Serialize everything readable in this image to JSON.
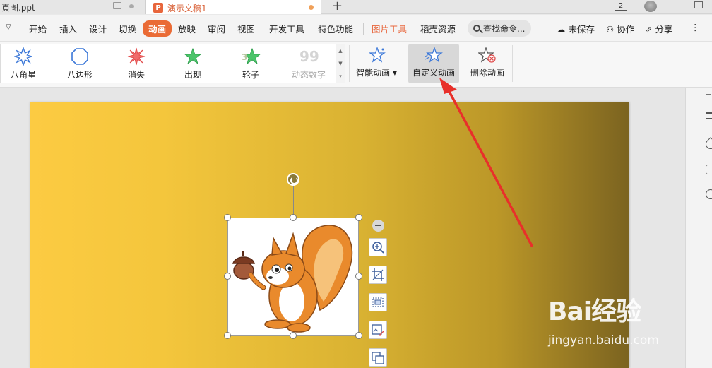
{
  "tabs": [
    {
      "label": "頁图.ppt"
    },
    {
      "label": "演示文稿1",
      "logo": "P"
    }
  ],
  "window": {
    "count": "2"
  },
  "menu": {
    "items": [
      "开始",
      "插入",
      "设计",
      "切换",
      "动画",
      "放映",
      "审阅",
      "视图",
      "开发工具",
      "特色功能"
    ],
    "active": "动画",
    "picture_tools": "图片工具",
    "daoke": "稻壳资源",
    "search_placeholder": "查找命令...",
    "unsaved": "未保存",
    "collab": "协作",
    "share": "分享"
  },
  "ribbon": {
    "gallery": [
      {
        "label": "八角星",
        "icon": "octagram-star-icon"
      },
      {
        "label": "八边形",
        "icon": "octagon-icon"
      },
      {
        "label": "消失",
        "icon": "burst-star-icon"
      },
      {
        "label": "出现",
        "icon": "green-star-icon"
      },
      {
        "label": "轮子",
        "icon": "wheel-icon"
      },
      {
        "label": "动态数字",
        "icon": "number-99-icon"
      }
    ],
    "smart_animation": "智能动画",
    "custom_animation": "自定义动画",
    "delete_animation": "删除动画"
  },
  "watermark": {
    "line1": "Bai经验",
    "line2": "jingyan.baidu.com"
  },
  "colors": {
    "accent": "#ea6b35",
    "annotation_arrow": "#e8302a"
  }
}
